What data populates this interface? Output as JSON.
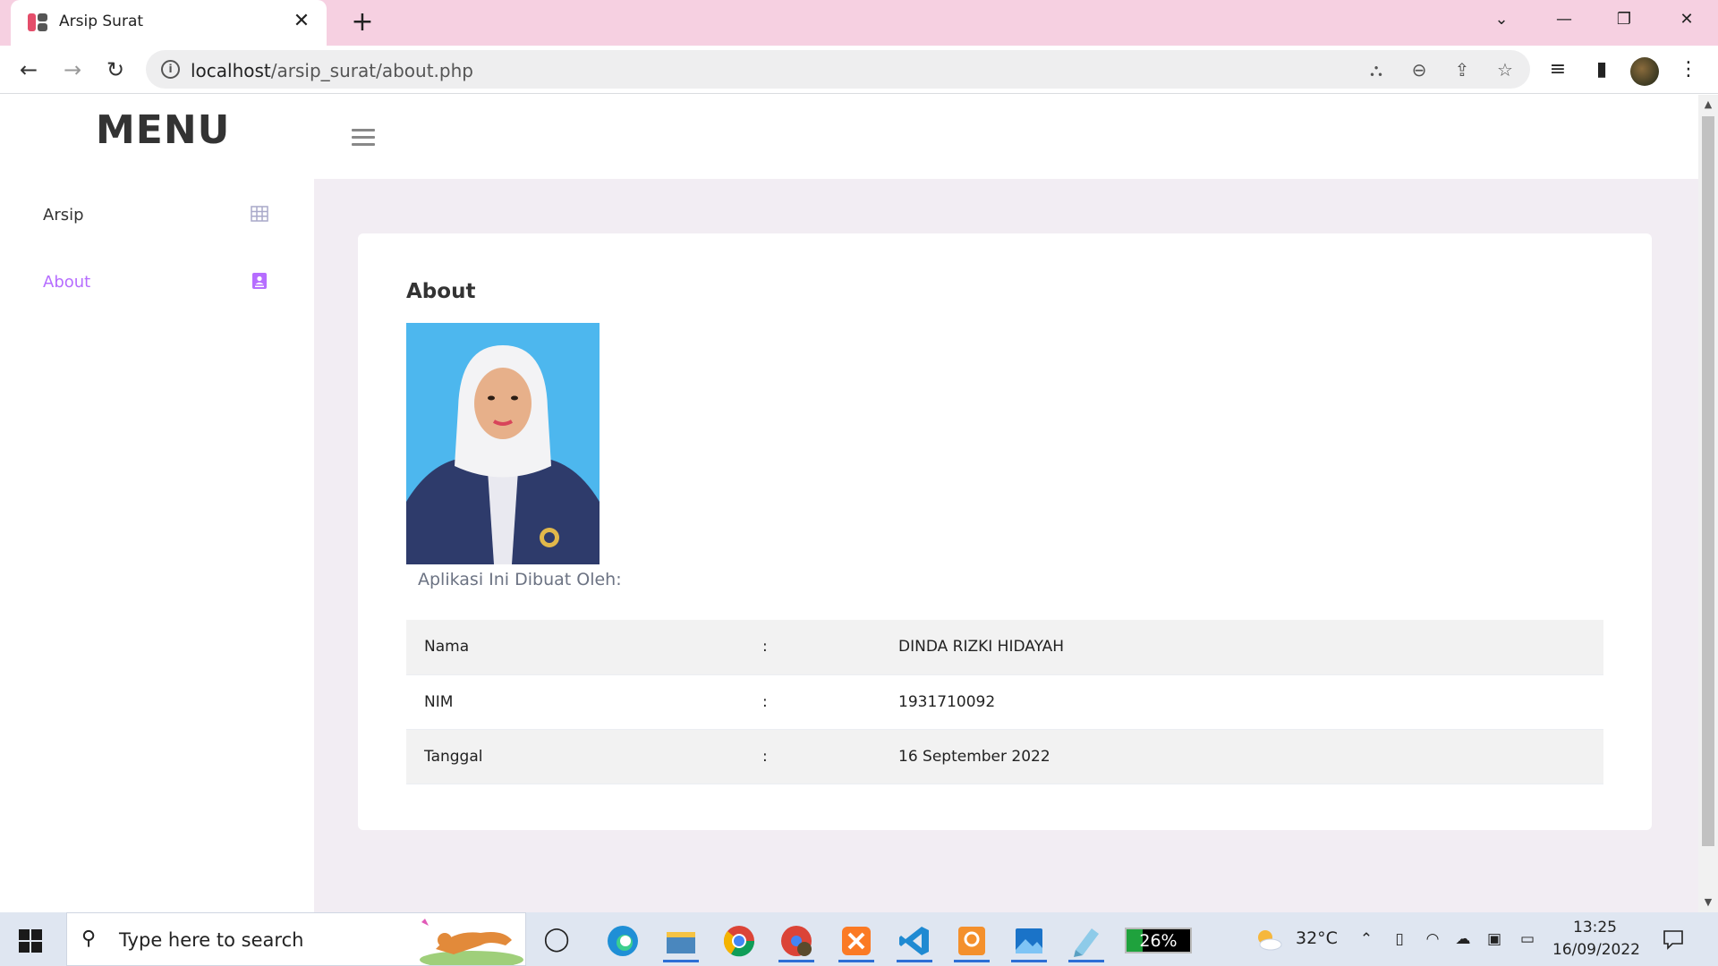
{
  "browser": {
    "tab_title": "Arsip Surat",
    "url_host": "localhost",
    "url_path": "/arsip_surat/about.php",
    "colors": {
      "tabbar": "#f6d0e1"
    }
  },
  "page": {
    "brand": "MENU",
    "sidebar": {
      "items": [
        {
          "label": "Arsip",
          "icon": "grid-icon",
          "active": false
        },
        {
          "label": "About",
          "icon": "contact-card-icon",
          "active": true
        }
      ]
    },
    "card": {
      "title": "About",
      "photo_alt": "profile-photo",
      "caption": "Aplikasi Ini Dibuat Oleh:",
      "rows": [
        {
          "label": "Nama",
          "sep": ":",
          "value": "DINDA RIZKI HIDAYAH"
        },
        {
          "label": "NIM",
          "sep": ":",
          "value": "1931710092"
        },
        {
          "label": "Tanggal",
          "sep": ":",
          "value": "16 September 2022"
        }
      ]
    },
    "colors": {
      "accent": "#b66dff",
      "content_bg": "#f2edf3"
    }
  },
  "taskbar": {
    "search_placeholder": "Type here to search",
    "battery_percent": "26%",
    "battery_level": 0.26,
    "temperature": "32°C",
    "time": "13:25",
    "date": "16/09/2022"
  }
}
